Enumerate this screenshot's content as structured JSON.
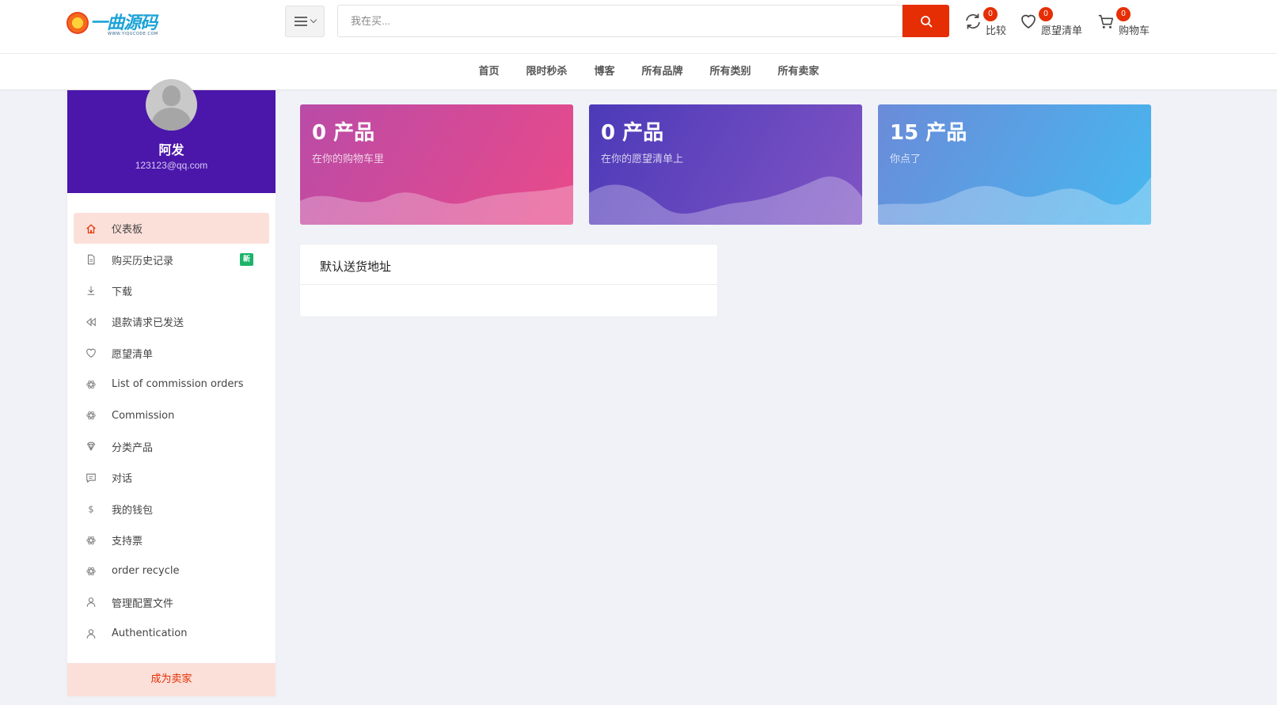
{
  "header": {
    "logo_text": "一曲源码",
    "logo_sub": "WWW.YIQUCODE.COM",
    "search_placeholder": "我在买...",
    "tools": [
      {
        "label": "比较",
        "count": "0",
        "icon": "refresh-icon"
      },
      {
        "label": "愿望清单",
        "count": "0",
        "icon": "heart-icon"
      },
      {
        "label": "购物车",
        "count": "0",
        "icon": "cart-icon"
      }
    ]
  },
  "nav": {
    "items": [
      "首页",
      "限时秒杀",
      "博客",
      "所有品牌",
      "所有类别",
      "所有卖家"
    ]
  },
  "profile": {
    "name": "阿发",
    "email": "123123@qq.com"
  },
  "sidebar": {
    "items": [
      {
        "label": "仪表板",
        "icon": "home-icon",
        "active": true
      },
      {
        "label": "购买历史记录",
        "icon": "file-icon",
        "badge": "新"
      },
      {
        "label": "下载",
        "icon": "download-icon"
      },
      {
        "label": "退款请求已发送",
        "icon": "backward-icon"
      },
      {
        "label": "愿望清单",
        "icon": "heart-icon"
      },
      {
        "label": "List of commission orders",
        "icon": "openai-icon"
      },
      {
        "label": "Commission",
        "icon": "openai-icon"
      },
      {
        "label": "分类产品",
        "icon": "diamond-icon"
      },
      {
        "label": "对话",
        "icon": "message-icon"
      },
      {
        "label": "我的钱包",
        "icon": "dollar-icon"
      },
      {
        "label": "支持票",
        "icon": "openai-icon"
      },
      {
        "label": "order recycle",
        "icon": "openai-icon"
      },
      {
        "label": "管理配置文件",
        "icon": "user-icon"
      },
      {
        "label": "Authentication",
        "icon": "user-icon"
      }
    ],
    "become_seller": "成为卖家"
  },
  "stats": [
    {
      "value": "0 产品",
      "caption": "在你的购物车里"
    },
    {
      "value": "0 产品",
      "caption": "在你的愿望清单上"
    },
    {
      "value": "15 产品",
      "caption": "你点了"
    }
  ],
  "address_card": {
    "title": "默认送货地址"
  },
  "colors": {
    "accent": "#e62e04",
    "profile_bg": "#4b16aa",
    "active_item_bg": "#fbe0d9",
    "new_badge": "#1db36a"
  }
}
